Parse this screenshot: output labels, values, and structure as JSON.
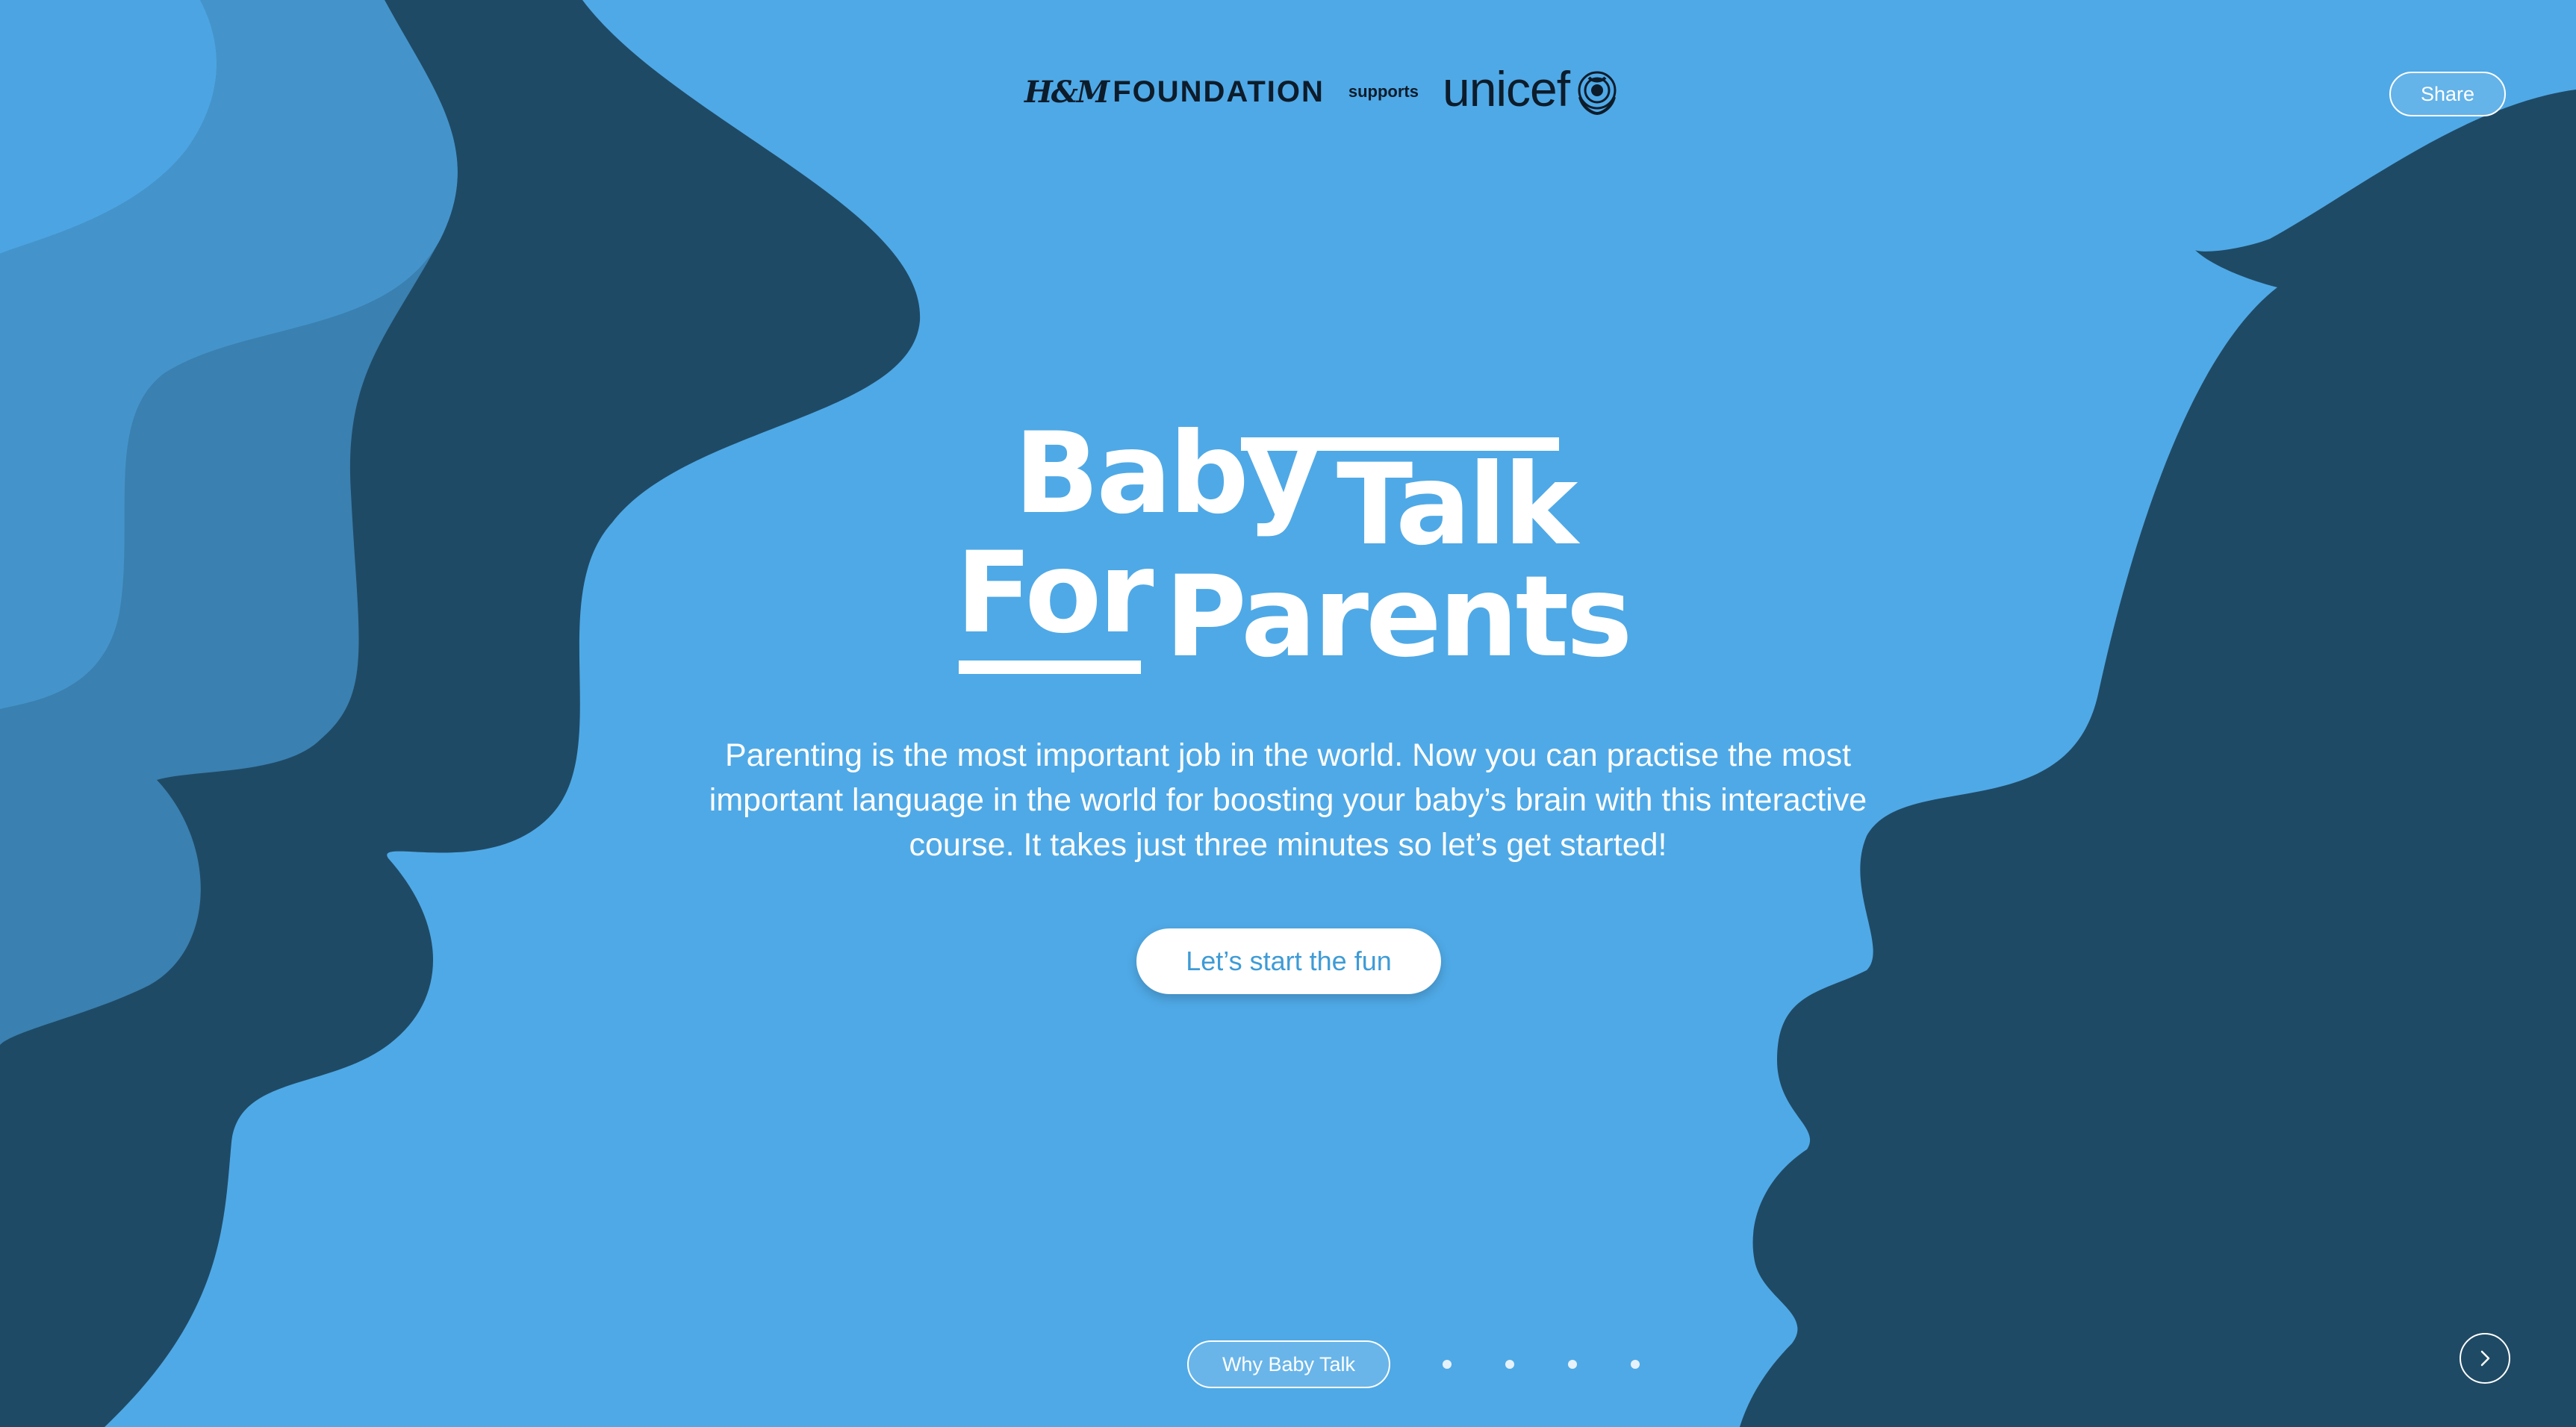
{
  "header": {
    "hm_mark": "H&M",
    "foundation": "FOUNDATION",
    "supports": "supports",
    "unicef": "unicef",
    "unicef_icon": "un-emblem-icon"
  },
  "share_label": "Share",
  "title": {
    "word1": "Baby",
    "word2": "Talk",
    "word3": "For",
    "word4": "Parents"
  },
  "intro": "Parenting is the most important job in the world. Now you can practise the most important language in the world for boosting your baby’s brain with this interactive course. It takes just three minutes so let’s get started!",
  "cta_label": "Let’s start the fun",
  "bottom_nav": {
    "section_label": "Why Baby Talk",
    "dots_count": 4,
    "next_icon": "chevron-right-icon"
  },
  "colors": {
    "background": "#4fa9e6",
    "dark_navy": "#1f4a65",
    "mid_blue": "#3a80b0",
    "light_blue": "#4494cb",
    "text_dark": "#0d1c2b",
    "cta_text": "#3e9bd6"
  }
}
